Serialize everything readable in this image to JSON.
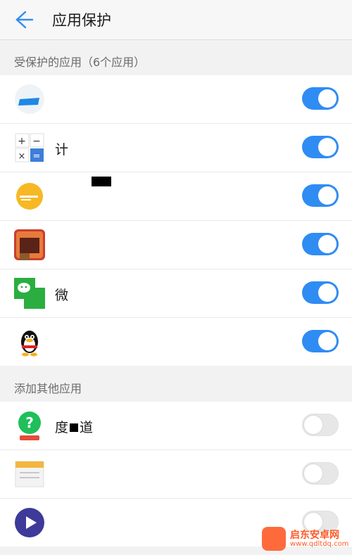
{
  "header": {
    "title": "应用保护"
  },
  "protected": {
    "label": "受保护的应用（6个应用）",
    "apps": [
      {
        "icon": "blue-book-icon",
        "name": "",
        "on": true
      },
      {
        "icon": "calculator-icon",
        "name": "计",
        "on": true
      },
      {
        "icon": "orange-circle-icon",
        "name": "",
        "on": true
      },
      {
        "icon": "game-icon",
        "name": "",
        "on": true
      },
      {
        "icon": "wechat-icon",
        "name": "微",
        "on": true
      },
      {
        "icon": "qq-penguin-icon",
        "name": "",
        "on": true
      }
    ]
  },
  "others": {
    "label": "添加其他应用",
    "apps": [
      {
        "icon": "question-badge-icon",
        "name": "度",
        "name_suffix": "道",
        "on": false
      },
      {
        "icon": "notes-icon",
        "name": "",
        "on": false
      },
      {
        "icon": "play-button-icon",
        "name": "",
        "on": false
      }
    ]
  },
  "watermark": {
    "title": "启东安卓网",
    "url": "www.qdltdq.com"
  },
  "colors": {
    "accent": "#2f8cf3",
    "off": "#e7e7e7"
  }
}
